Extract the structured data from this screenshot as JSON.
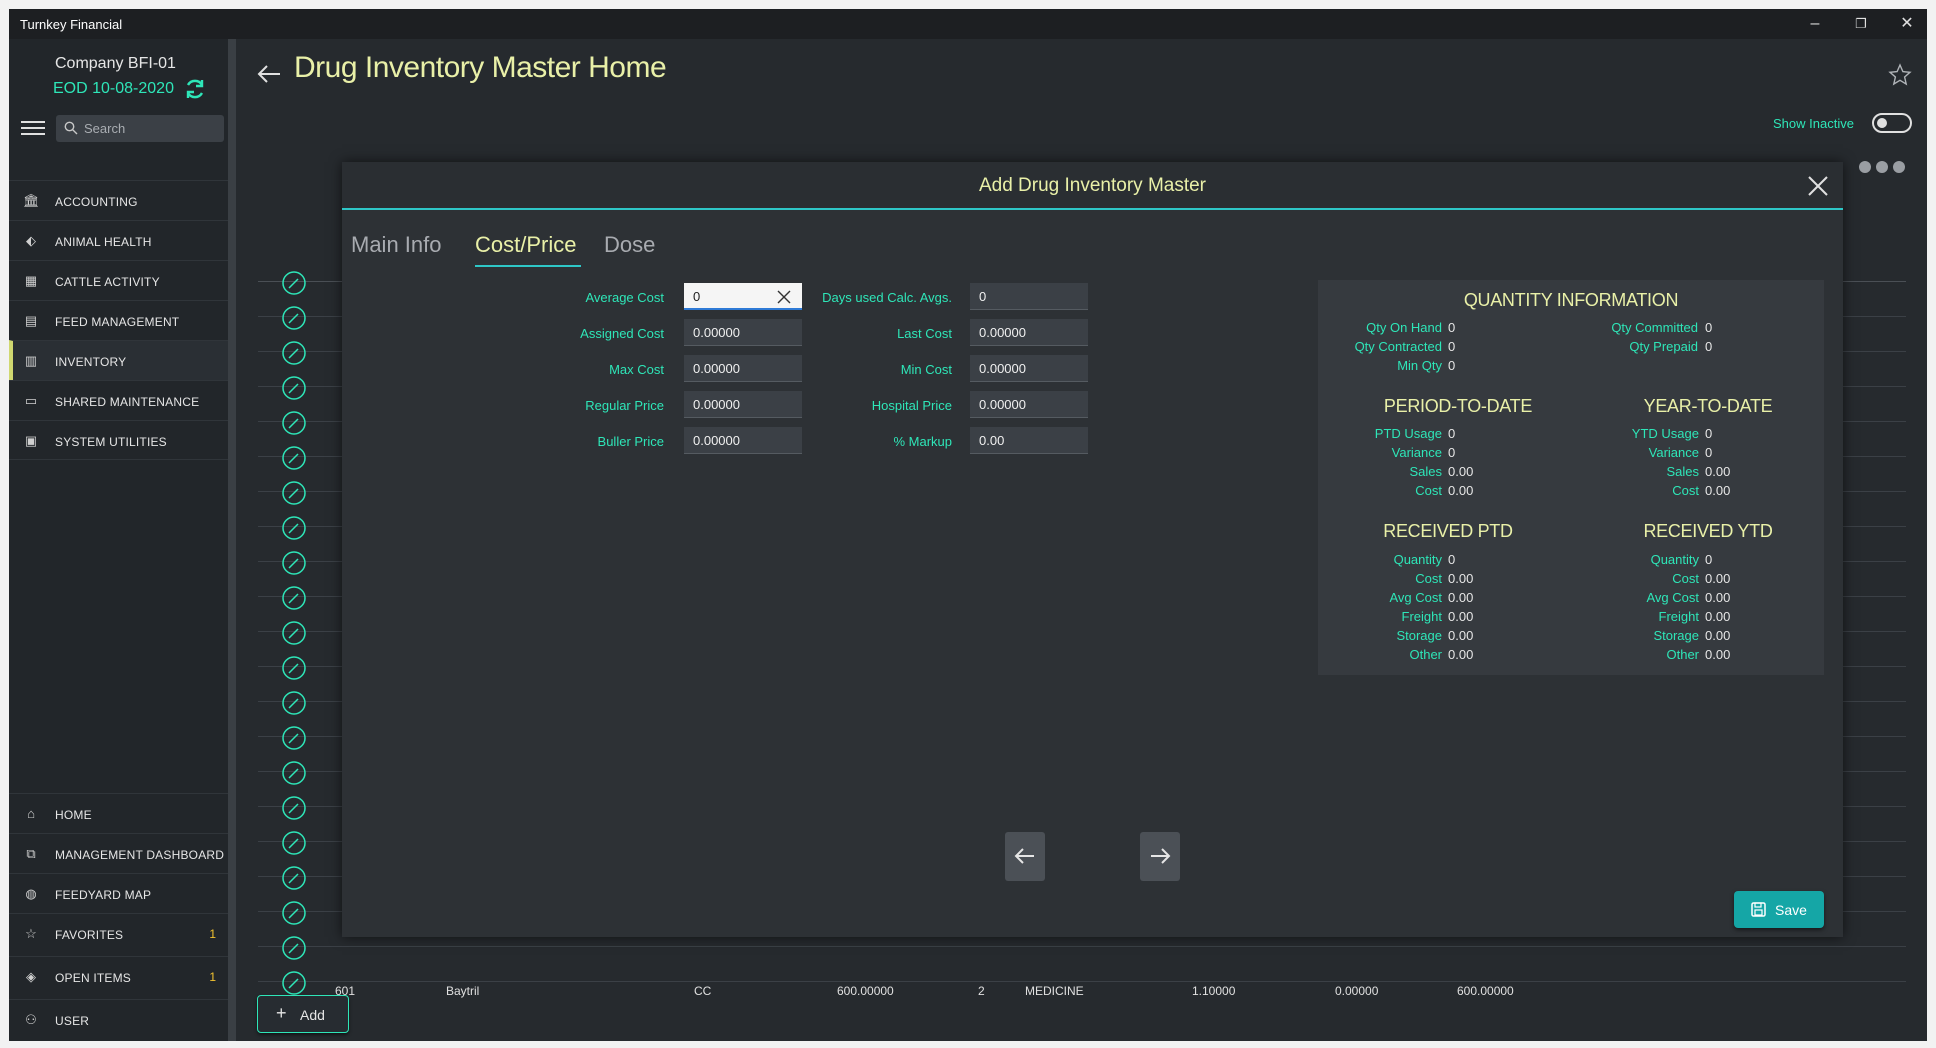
{
  "window": {
    "title": "Turnkey Financial",
    "controls": {
      "minimize": "–",
      "restore": "❐",
      "close": "✕"
    }
  },
  "sidebar": {
    "company": "Company BFI-01",
    "eod": "EOD 10-08-2020",
    "search_placeholder": "Search",
    "top_items": [
      {
        "label": "ACCOUNTING",
        "icon": "bank-icon"
      },
      {
        "label": "ANIMAL HEALTH",
        "icon": "tag-icon"
      },
      {
        "label": "CATTLE ACTIVITY",
        "icon": "grid-icon"
      },
      {
        "label": "FEED MANAGEMENT",
        "icon": "feed-icon"
      },
      {
        "label": "INVENTORY",
        "icon": "inventory-icon"
      },
      {
        "label": "SHARED MAINTENANCE",
        "icon": "folder-icon"
      },
      {
        "label": "SYSTEM UTILITIES",
        "icon": "chat-icon"
      }
    ],
    "bottom_items": [
      {
        "label": "HOME",
        "icon": "home-icon",
        "badge": ""
      },
      {
        "label": "MANAGEMENT DASHBOARD",
        "icon": "dashboard-icon",
        "badge": ""
      },
      {
        "label": "FEEDYARD MAP",
        "icon": "globe-icon",
        "badge": ""
      },
      {
        "label": "FAVORITES",
        "icon": "star-icon",
        "badge": "1"
      },
      {
        "label": "OPEN ITEMS",
        "icon": "layers-icon",
        "badge": "1"
      },
      {
        "label": "USER",
        "icon": "user-icon",
        "badge": ""
      }
    ]
  },
  "header": {
    "title": "Drug Inventory Master Home",
    "show_inactive": "Show Inactive"
  },
  "table": {
    "last_row": [
      "601",
      "Baytril",
      "CC",
      "600.00000",
      "2",
      "MEDICINE",
      "1.10000",
      "0.00000",
      "600.00000"
    ]
  },
  "add_label": "Add",
  "modal": {
    "title": "Add Drug Inventory Master",
    "tabs": [
      "Main Info",
      "Cost/Price",
      "Dose"
    ],
    "left_fields": [
      {
        "label": "Average Cost",
        "value": "0"
      },
      {
        "label": "Assigned Cost",
        "value": "0.00000"
      },
      {
        "label": "Max Cost",
        "value": "0.00000"
      },
      {
        "label": "Regular Price",
        "value": "0.00000"
      },
      {
        "label": "Buller Price",
        "value": "0.00000"
      }
    ],
    "right_fields": [
      {
        "label": "Days used Calc. Avgs.",
        "value": "0"
      },
      {
        "label": "Last Cost",
        "value": "0.00000"
      },
      {
        "label": "Min Cost",
        "value": "0.00000"
      },
      {
        "label": "Hospital Price",
        "value": "0.00000"
      },
      {
        "label": "% Markup",
        "value": "0.00"
      }
    ],
    "quantity": {
      "heading": "QUANTITY INFORMATION",
      "left": [
        {
          "label": "Qty On Hand",
          "value": "0"
        },
        {
          "label": "Qty Contracted",
          "value": "0"
        },
        {
          "label": "Min Qty",
          "value": "0"
        }
      ],
      "right": [
        {
          "label": "Qty Committed",
          "value": "0"
        },
        {
          "label": "Qty Prepaid",
          "value": "0"
        }
      ],
      "ptd_heading": "PERIOD-TO-DATE",
      "ptd": [
        {
          "label": "PTD Usage",
          "value": "0"
        },
        {
          "label": "Variance",
          "value": "0"
        },
        {
          "label": "Sales",
          "value": "0.00"
        },
        {
          "label": "Cost",
          "value": "0.00"
        }
      ],
      "ytd_heading": "YEAR-TO-DATE",
      "ytd": [
        {
          "label": "YTD Usage",
          "value": "0"
        },
        {
          "label": "Variance",
          "value": "0"
        },
        {
          "label": "Sales",
          "value": "0.00"
        },
        {
          "label": "Cost",
          "value": "0.00"
        }
      ],
      "rptd_heading": "RECEIVED PTD",
      "rptd": [
        {
          "label": "Quantity",
          "value": "0"
        },
        {
          "label": "Cost",
          "value": "0.00"
        },
        {
          "label": "Avg Cost",
          "value": "0.00"
        },
        {
          "label": "Freight",
          "value": "0.00"
        },
        {
          "label": "Storage",
          "value": "0.00"
        },
        {
          "label": "Other",
          "value": "0.00"
        }
      ],
      "rytd_heading": "RECEIVED YTD",
      "rytd": [
        {
          "label": "Quantity",
          "value": "0"
        },
        {
          "label": "Cost",
          "value": "0.00"
        },
        {
          "label": "Avg Cost",
          "value": "0.00"
        },
        {
          "label": "Freight",
          "value": "0.00"
        },
        {
          "label": "Storage",
          "value": "0.00"
        },
        {
          "label": "Other",
          "value": "0.00"
        }
      ]
    },
    "save_label": "Save"
  },
  "colors": {
    "accent_teal": "#2ee6b8",
    "title_yellow": "#e9f0a8",
    "save_teal": "#15a6a6",
    "badge_yellow": "#f2c230"
  }
}
